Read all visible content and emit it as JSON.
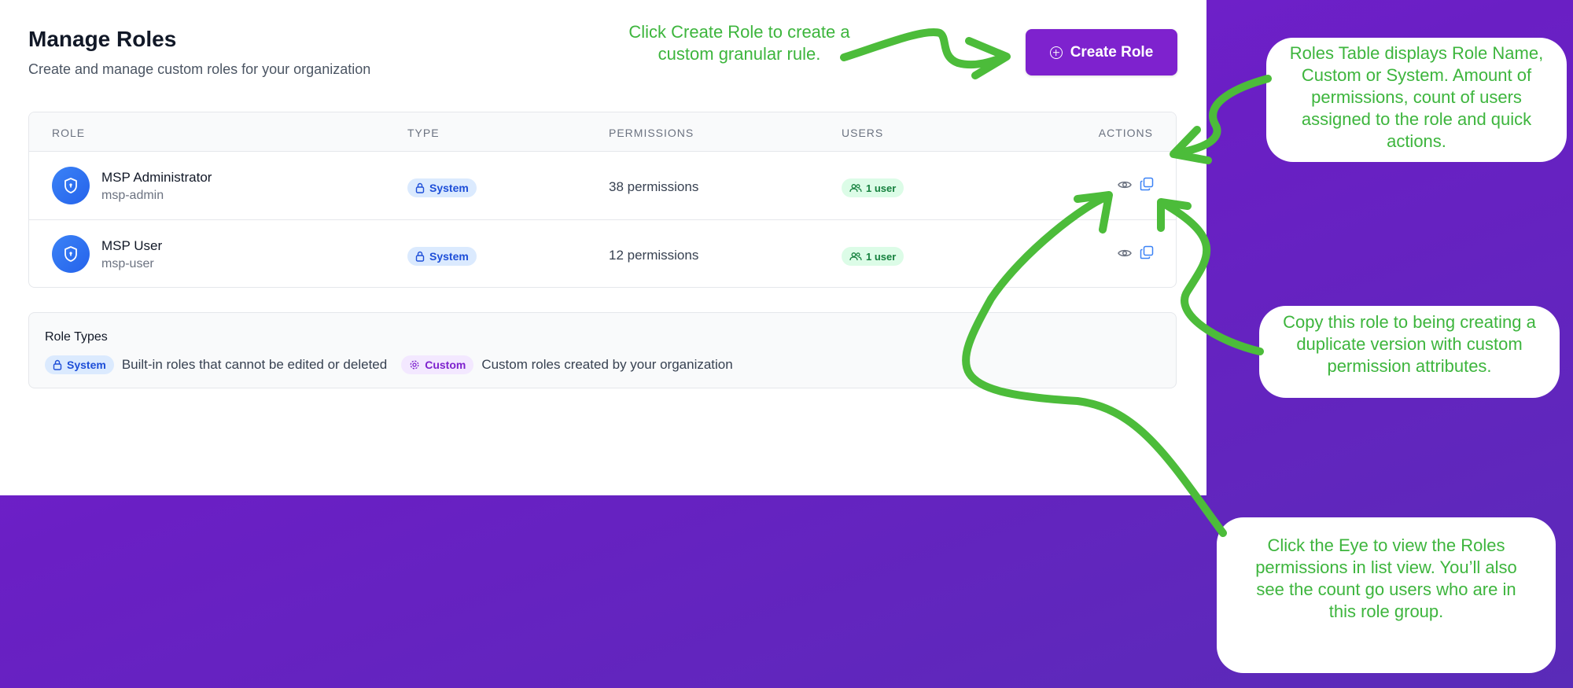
{
  "page": {
    "title": "Manage Roles",
    "subtitle": "Create and manage custom roles for your organization",
    "create_button": "Create Role"
  },
  "table": {
    "headers": [
      "ROLE",
      "TYPE",
      "PERMISSIONS",
      "USERS",
      "ACTIONS"
    ],
    "rows": [
      {
        "name": "MSP Administrator",
        "slug": "msp-admin",
        "type": "System",
        "permissions": "38 permissions",
        "users": "1 user"
      },
      {
        "name": "MSP User",
        "slug": "msp-user",
        "type": "System",
        "permissions": "12 permissions",
        "users": "1 user"
      }
    ]
  },
  "role_types": {
    "title": "Role Types",
    "system_label": "System",
    "system_desc": "Built-in roles that cannot be edited or deleted",
    "custom_label": "Custom",
    "custom_desc": "Custom roles created by your organization"
  },
  "annotations": {
    "create": "Click Create Role to create a custom granular rule.",
    "table": "Roles Table displays Role Name, Custom or System. Amount of permissions, count of users assigned to the role and quick actions.",
    "copy": "Copy this role to being creating a duplicate version with custom permission attributes.",
    "eye": "Click the Eye to view the Roles permissions in list view. You’ll also see the count go users who are in this role group."
  },
  "colors": {
    "accent": "#7e22ce",
    "annotation_green": "#3db53d",
    "background_purple": "#6a1fc4"
  },
  "icons": [
    "plus-circle-icon",
    "shield-icon",
    "lock-icon",
    "users-icon",
    "eye-icon",
    "copy-icon",
    "gear-icon"
  ]
}
